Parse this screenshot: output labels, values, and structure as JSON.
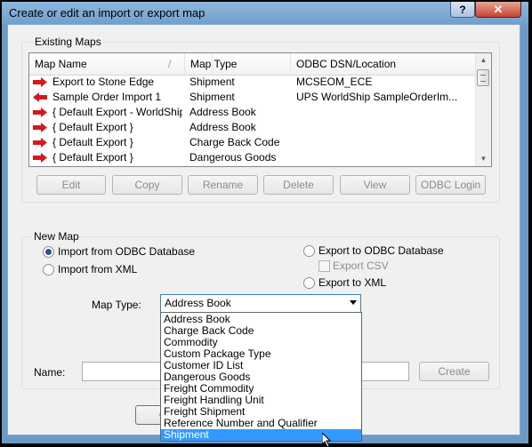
{
  "window": {
    "title": "Create or edit an import or export map",
    "help_label": "?",
    "close_label": "✕"
  },
  "existing_maps": {
    "group_label": "Existing Maps",
    "columns": [
      "Map Name",
      "Map Type",
      "ODBC DSN/Location"
    ],
    "sort_glyph": "/",
    "rows": [
      {
        "name": "Export to Stone Edge",
        "type": "Shipment",
        "location": "MCSEOM_ECE",
        "icon": "red-right-arrow-icon"
      },
      {
        "name": "Sample Order Import 1",
        "type": "Shipment",
        "location": "UPS WorldShip SampleOrderIm...",
        "icon": "red-left-arrow-icon"
      },
      {
        "name": "{ Default Export - WorldShip }",
        "type": "Address Book",
        "location": "",
        "icon": "red-right-arrow-icon"
      },
      {
        "name": "{ Default Export }",
        "type": "Address Book",
        "location": "",
        "icon": "red-right-arrow-icon"
      },
      {
        "name": "{ Default Export }",
        "type": "Charge Back Code",
        "location": "",
        "icon": "red-right-arrow-icon"
      },
      {
        "name": "{ Default Export }",
        "type": "Dangerous Goods",
        "location": "",
        "icon": "red-right-arrow-icon"
      }
    ],
    "buttons": {
      "edit": "Edit",
      "copy": "Copy",
      "rename": "Rename",
      "delete": "Delete",
      "view": "View",
      "odbc_login": "ODBC Login"
    }
  },
  "new_map": {
    "group_label": "New Map",
    "import_odbc": "Import from ODBC Database",
    "import_xml": "Import from XML",
    "export_odbc": "Export to ODBC Database",
    "export_csv": "Export CSV",
    "export_xml": "Export to XML",
    "map_type_label": "Map Type:",
    "map_type_value": "Address Book",
    "map_type_options": [
      "Address Book",
      "Charge Back Code",
      "Commodity",
      "Custom Package Type",
      "Customer ID List",
      "Dangerous Goods",
      "Freight Commodity",
      "Freight Handling Unit",
      "Freight Shipment",
      "Reference Number and Qualifier",
      "Shipment"
    ],
    "highlighted_option": "Shipment",
    "name_label": "Name:",
    "name_value": "",
    "create_button": "Create"
  },
  "footer": {
    "partial_button_label": "C"
  },
  "colors": {
    "accent": "#3399ff",
    "titlebar": "#6f9fcd",
    "close": "#c7442f",
    "arrow": "#d41a1a"
  }
}
